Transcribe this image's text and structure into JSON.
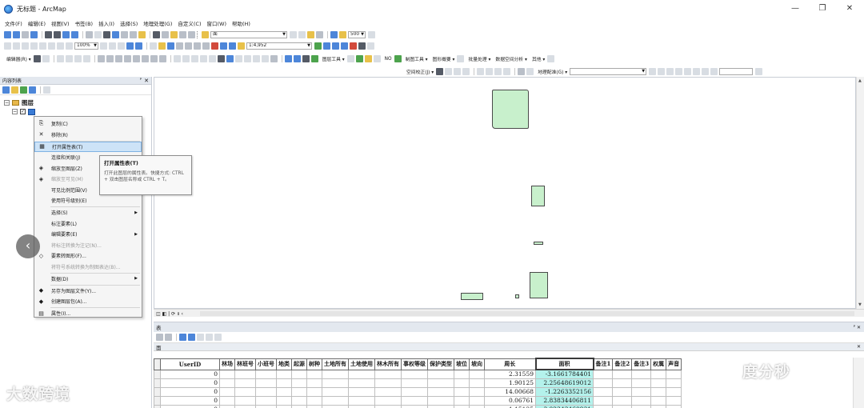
{
  "window": {
    "title": "无标题 - ArcMap",
    "minimize": "—",
    "maximize": "❐",
    "close": "✕"
  },
  "menu": [
    "文件(F)",
    "编辑(E)",
    "视图(V)",
    "书签(B)",
    "插入(I)",
    "选择(S)",
    "地理处理(G)",
    "自定义(C)",
    "窗口(W)",
    "帮助(H)"
  ],
  "toolbar": {
    "layer_combo": "面",
    "zoom_value": "100%",
    "size_value": "500",
    "scale_value": "1:4,952",
    "editor_label": "编辑器(R) ▾",
    "raster_labels": [
      "NO",
      "制图工具 ▾",
      "图形概要 ▾",
      "批量处理 ▾",
      "数据空间分析 ▾",
      "其他 ▾"
    ],
    "georef_labels": [
      "空间校正(J) ▾",
      "地理配准(G) ▾"
    ],
    "annotation_label": "图层工具 ▾"
  },
  "toc": {
    "title": "内容列表",
    "pin": "ᴾ",
    "close": "✕",
    "root_label": "图层"
  },
  "context_menu": {
    "items": [
      {
        "label": "复制(C)",
        "icon": "copy-icon",
        "glyph": "⎘",
        "disabled": false,
        "submenu": false
      },
      {
        "label": "移除(R)",
        "icon": "remove-icon",
        "glyph": "✕",
        "disabled": false,
        "submenu": false
      },
      {
        "label": "打开属性表(T)",
        "icon": "table-icon",
        "glyph": "▦",
        "disabled": false,
        "submenu": false,
        "highlight": true
      },
      {
        "label": "连接和关联(J)",
        "icon": "",
        "glyph": "",
        "disabled": false,
        "submenu": true
      },
      {
        "label": "缩放至图层(Z)",
        "icon": "zoom-layer-icon",
        "glyph": "◈",
        "disabled": false,
        "submenu": false
      },
      {
        "label": "缩放至可见(M)",
        "icon": "zoom-visible-icon",
        "glyph": "◈",
        "disabled": true,
        "submenu": false
      },
      {
        "label": "可见比例范围(V)",
        "icon": "",
        "glyph": "",
        "disabled": false,
        "submenu": true
      },
      {
        "label": "使用符号级别(E)",
        "icon": "",
        "glyph": "",
        "disabled": false,
        "submenu": false
      },
      {
        "label": "选择(S)",
        "icon": "",
        "glyph": "",
        "disabled": false,
        "submenu": true
      },
      {
        "label": "标注要素(L)",
        "icon": "",
        "glyph": "",
        "disabled": false,
        "submenu": false
      },
      {
        "label": "编辑要素(E)",
        "icon": "",
        "glyph": "",
        "disabled": false,
        "submenu": true
      },
      {
        "label": "将标注转换为注记(N)...",
        "icon": "",
        "glyph": "",
        "disabled": true,
        "submenu": false
      },
      {
        "label": "要素转图形(F)...",
        "icon": "convert-graphics-icon",
        "glyph": "◇",
        "disabled": false,
        "submenu": false
      },
      {
        "label": "将符号系统转换为制图表达(B)...",
        "icon": "",
        "glyph": "",
        "disabled": true,
        "submenu": false
      },
      {
        "label": "数据(D)",
        "icon": "",
        "glyph": "",
        "disabled": false,
        "submenu": true
      },
      {
        "label": "另存为图层文件(Y)...",
        "icon": "save-layer-icon",
        "glyph": "◆",
        "disabled": false,
        "submenu": false
      },
      {
        "label": "创建图层包(A)...",
        "icon": "layer-package-icon",
        "glyph": "◆",
        "disabled": false,
        "submenu": false
      },
      {
        "label": "属性(I)...",
        "icon": "properties-icon",
        "glyph": "▤",
        "disabled": false,
        "submenu": false
      }
    ],
    "submenu_arrow": "▶"
  },
  "tooltip": {
    "title": "打开属性表(T)",
    "body": "打开此图层的属性表。快捷方式: CTRL + 双击图层名称或 CTRL + T。"
  },
  "nav": {
    "back_label": "‹"
  },
  "map": {
    "polygon_fill": "#c8f0cc",
    "bottom_label": "◫ ◧ | ⟳ ॥ ‹"
  },
  "table_window": {
    "title": "表",
    "controls": "ᴾ ✕",
    "tab_label": "面",
    "tab_close": "✕",
    "columns": [
      "UserID",
      "林场",
      "林班号",
      "小班号",
      "地类",
      "起源",
      "树种",
      "土地所有",
      "土地使用",
      "林木所有",
      "事权等级",
      "保护类型",
      "坡位",
      "坡向",
      "周长",
      "面积",
      "备注1",
      "备注2",
      "备注3",
      "权属",
      "声音"
    ],
    "rows": [
      [
        "0",
        "",
        "",
        "",
        "",
        "",
        "",
        "",
        "",
        "",
        "",
        "",
        "",
        "",
        "2.31559",
        "-3.1661784401",
        "",
        "",
        "",
        "",
        ""
      ],
      [
        "0",
        "",
        "",
        "",
        "",
        "",
        "",
        "",
        "",
        "",
        "",
        "",
        "",
        "",
        "1.90125",
        "2.25648619012",
        "",
        "",
        "",
        "",
        ""
      ],
      [
        "0",
        "",
        "",
        "",
        "",
        "",
        "",
        "",
        "",
        "",
        "",
        "",
        "",
        "",
        "14.00668",
        "-1.2263352156",
        "",
        "",
        "",
        "",
        ""
      ],
      [
        "0",
        "",
        "",
        "",
        "",
        "",
        "",
        "",
        "",
        "",
        "",
        "",
        "",
        "",
        "0.06761",
        "2.83834406811",
        "",
        "",
        "",
        "",
        ""
      ],
      [
        "0",
        "",
        "",
        "",
        "",
        "",
        "",
        "",
        "",
        "",
        "",
        "",
        "",
        "",
        "1.15125",
        "3.02343460831",
        "",
        "",
        "",
        "",
        ""
      ]
    ]
  },
  "watermarks": {
    "left": "大数跨境",
    "right": "度分秒"
  }
}
